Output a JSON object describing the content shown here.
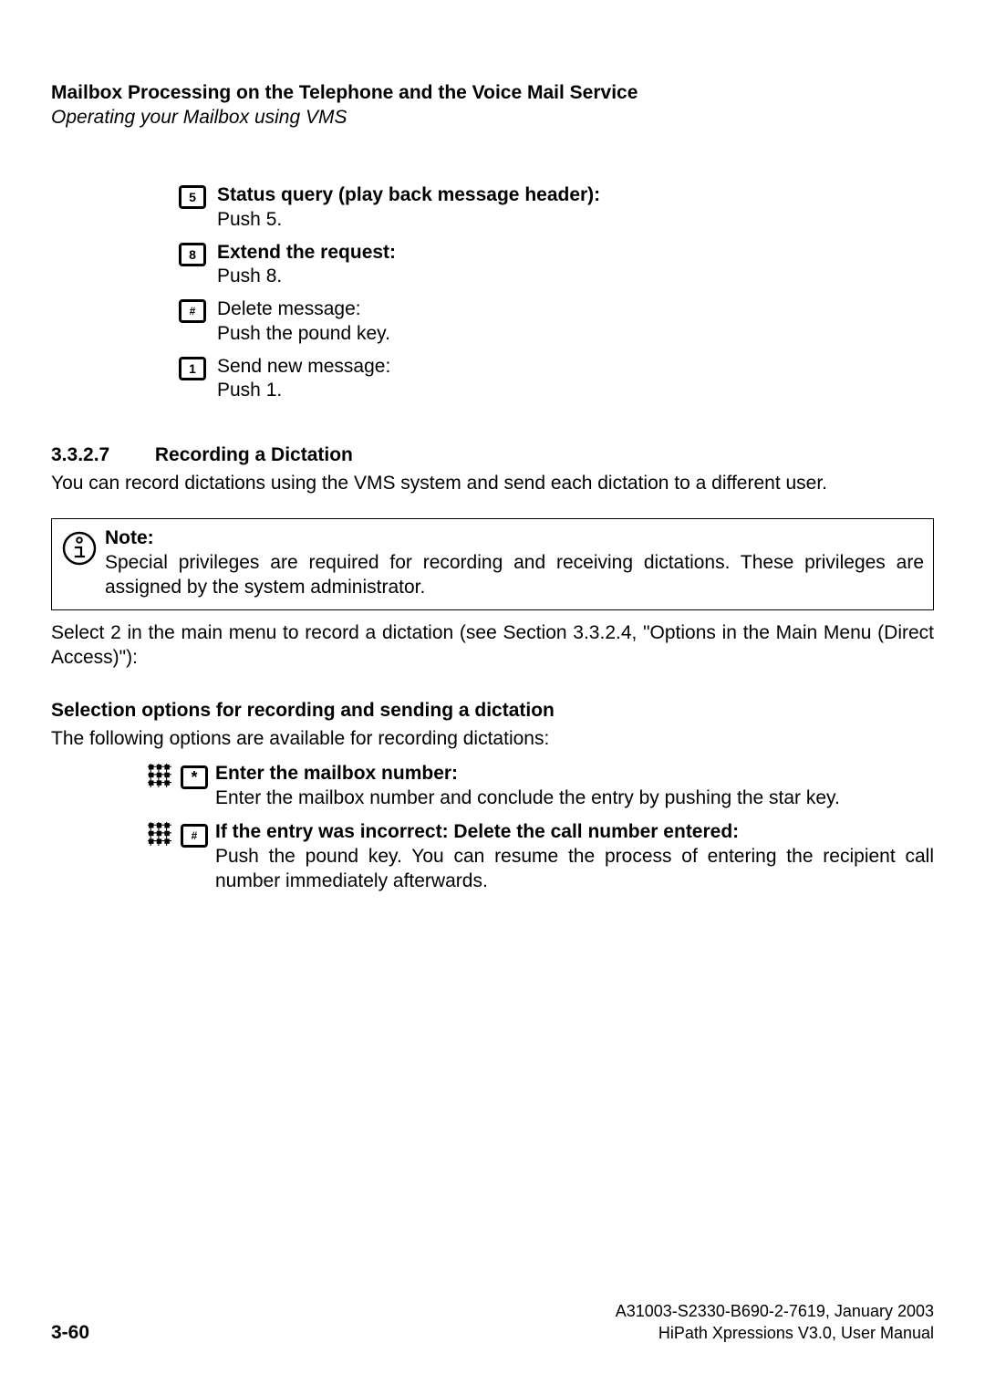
{
  "header": {
    "title": "Mailbox Processing on the Telephone and the Voice Mail Service",
    "subtitle": "Operating your Mailbox using VMS"
  },
  "steps": [
    {
      "key": "5",
      "label": "Status query (play back message header):",
      "desc": "Push 5."
    },
    {
      "key": "8",
      "label": "Extend the request:",
      "desc": "Push 8."
    },
    {
      "key": "#",
      "label": "",
      "desc": "Delete message:\nPush the pound key."
    },
    {
      "key": "1",
      "label": "",
      "desc": "Send new message:\nPush 1."
    }
  ],
  "section": {
    "number": "3.3.2.7",
    "title": "Recording a Dictation",
    "intro": "You can record dictations using the VMS system and send each dictation to a different user."
  },
  "note": {
    "heading": "Note:",
    "body": "Special privileges are required for recording and receiving dictations. These privileges are assigned by the system administrator."
  },
  "after_note": "Select 2 in the main menu to record a dictation (see Section 3.3.2.4, \"Options in the Main Menu (Direct Access)\"):",
  "options_heading": "Selection options for recording and sending a dictation",
  "options_intro": "The following options are available for recording dictations:",
  "options": [
    {
      "key": "*",
      "label": "Enter the mailbox number:",
      "desc": "Enter the mailbox number and conclude the entry by pushing the star key."
    },
    {
      "key": "#",
      "label": "If the entry was incorrect: Delete the call number entered:",
      "desc": "Push the pound key. You can resume the process of entering the recipient call number immediately afterwards."
    }
  ],
  "footer": {
    "page": "3-60",
    "doc_id": "A31003-S2330-B690-2-7619, January 2003",
    "product": "HiPath Xpressions V3.0, User Manual"
  }
}
